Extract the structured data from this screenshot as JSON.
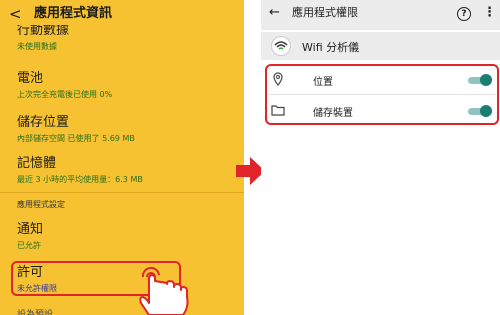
{
  "left_panel": {
    "back_glyph": "<",
    "title": "應用程式資訊",
    "cut_item": {
      "title": "行動數據",
      "subtitle": "未使用數據"
    },
    "items": [
      {
        "title": "電池",
        "subtitle": "上次完全充電後已使用 0%"
      },
      {
        "title": "儲存位置",
        "subtitle": "內部儲存空間 已使用了 5.69 MB"
      },
      {
        "title": "記憶體",
        "subtitle": "最近 3 小時的平均使用量：6.3 MB"
      }
    ],
    "section_label": "應用程式設定",
    "notify": {
      "title": "通知",
      "subtitle": "已允許"
    },
    "permission": {
      "title": "許可",
      "subtitle": "未允許權限"
    },
    "bottom_cut": "設為預設"
  },
  "right_panel": {
    "back_glyph": "←",
    "title": "應用程式權限",
    "help_glyph": "?",
    "more_glyph": "⋮",
    "app_name": "Wifi 分析儀",
    "permissions": [
      {
        "label": "位置",
        "icon": "location-pin-icon",
        "enabled": true
      },
      {
        "label": "儲存裝置",
        "icon": "folder-icon",
        "enabled": true
      }
    ]
  },
  "colors": {
    "left_bg": "#f6c231",
    "highlight": "#e0242a",
    "toggle_on": "#1a7f6f",
    "arrow": "#e0242a"
  }
}
